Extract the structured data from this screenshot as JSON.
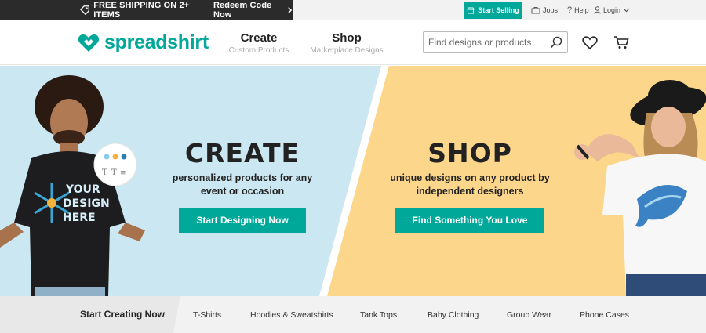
{
  "promo": {
    "shipping": "FREE SHIPPING ON 2+ ITEMS",
    "redeem": "Redeem Code Now"
  },
  "utility": {
    "start_selling": "Start Selling",
    "jobs": "Jobs",
    "help": "Help",
    "login": "Login"
  },
  "header": {
    "logo": "spreadshirt",
    "nav": [
      {
        "title": "Create",
        "subtitle": "Custom Products"
      },
      {
        "title": "Shop",
        "subtitle": "Marketplace Designs"
      }
    ],
    "search_placeholder": "Find designs or products"
  },
  "hero": {
    "create": {
      "title": "CREATE",
      "line1": "personalized products for any",
      "line2": "event or occasion",
      "cta": "Start Designing Now"
    },
    "shop": {
      "title": "SHOP",
      "line1": "unique designs on any product by",
      "line2": "independent designers",
      "cta": "Find Something You Love"
    },
    "shirt_text": [
      "YOUR",
      "DESIGN",
      "HERE"
    ]
  },
  "categories": {
    "lead": "Start Creating Now",
    "items": [
      "T-Shirts",
      "Hoodies & Sweatshirts",
      "Tank Tops",
      "Baby Clothing",
      "Group Wear",
      "Phone Cases"
    ]
  },
  "colors": {
    "brand": "#00a89a",
    "create_bg": "#cbe7f2",
    "shop_bg": "#fcd68a"
  }
}
